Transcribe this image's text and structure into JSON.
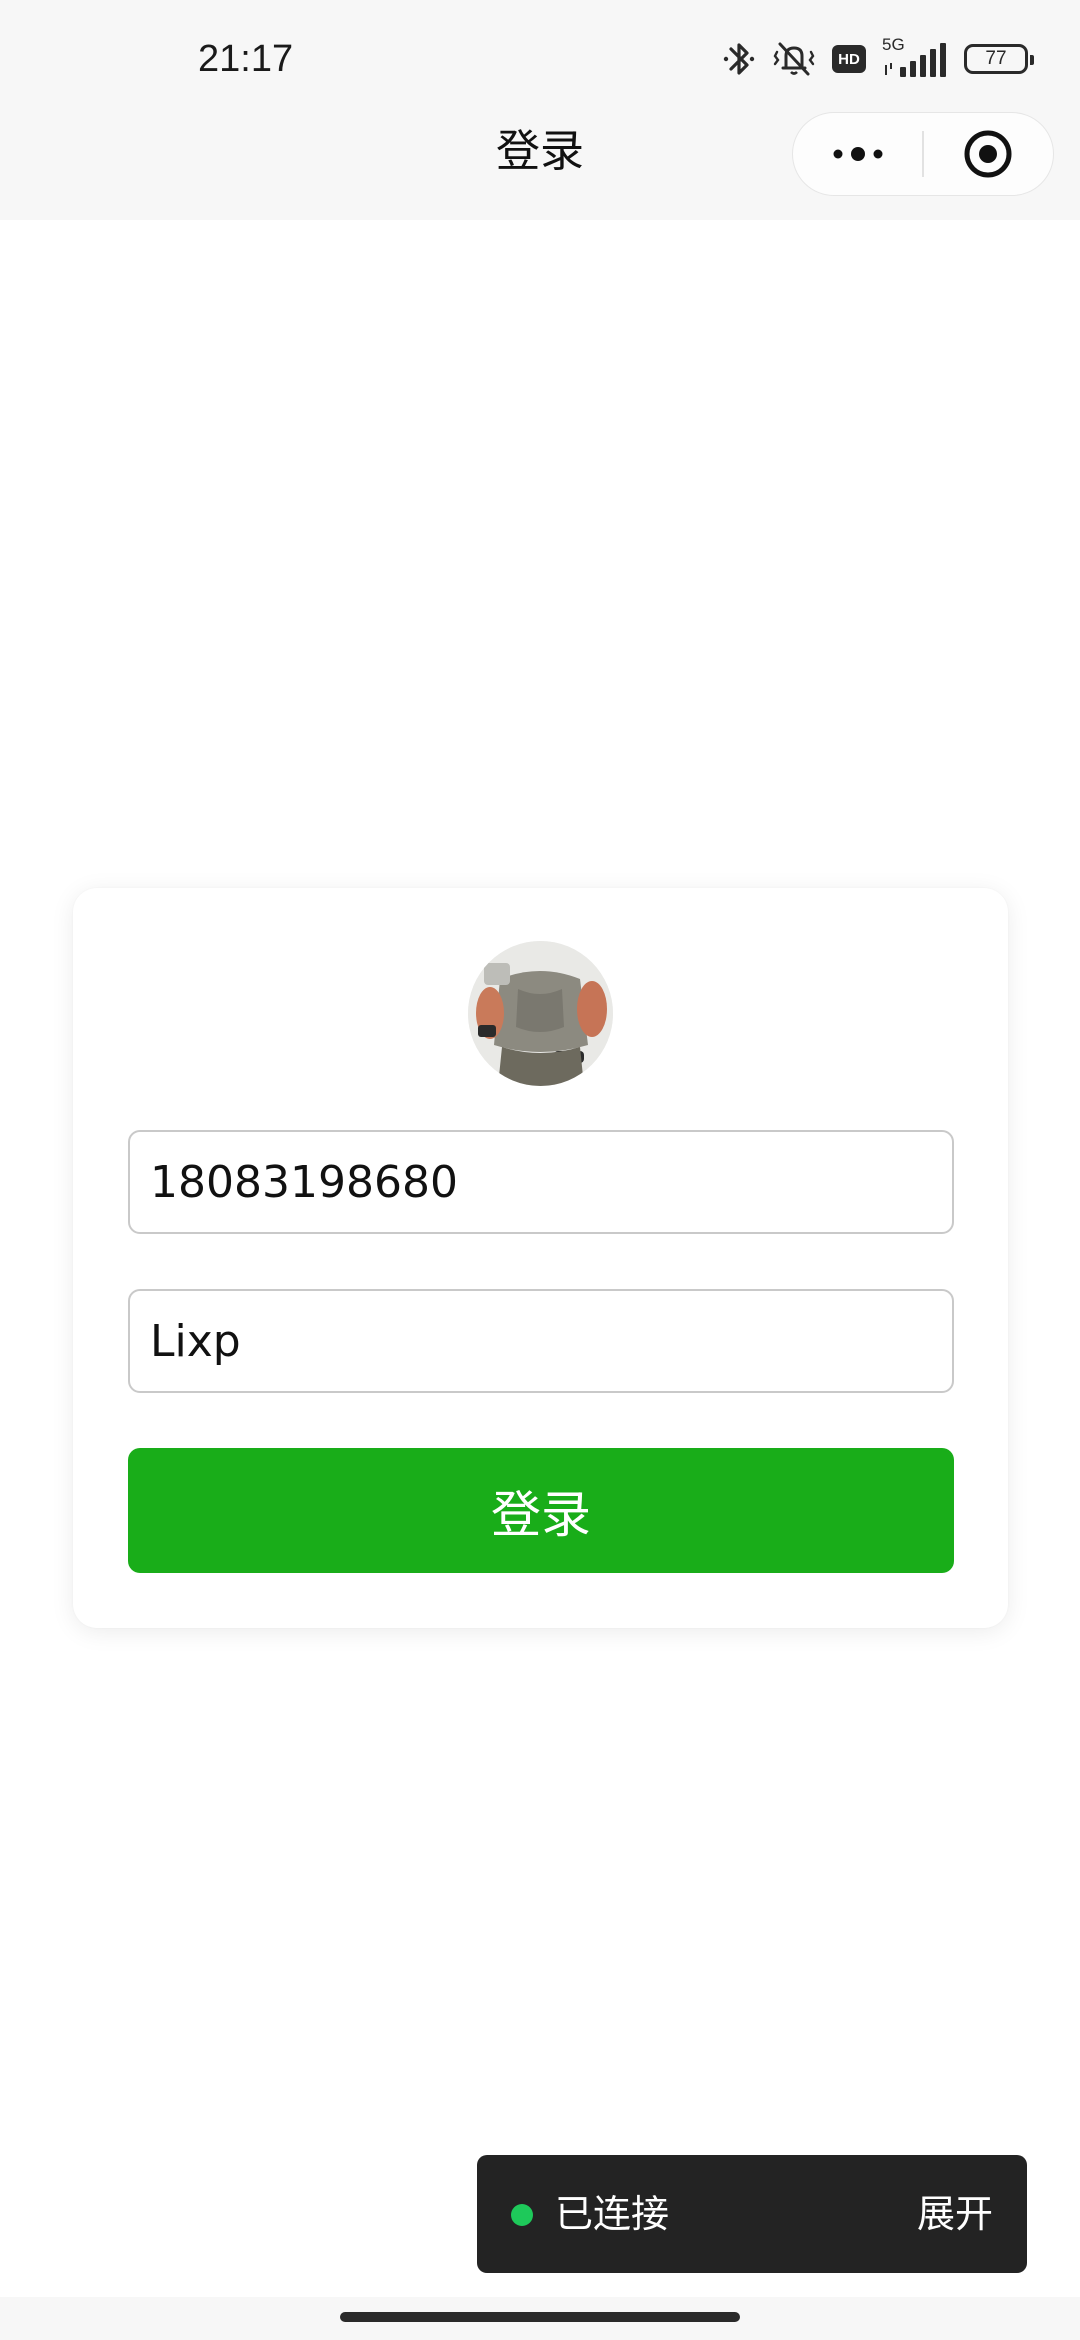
{
  "status_bar": {
    "time": "21:17",
    "network": "5G",
    "hd": "HD",
    "battery": "77"
  },
  "header": {
    "title": "登录"
  },
  "login_form": {
    "avatar_description": "profile-avatar",
    "phone_value": "18083198680",
    "password_value": "Lixp",
    "submit_label": "登录"
  },
  "connection_toast": {
    "status": "已连接",
    "expand_label": "展开",
    "status_color": "#1ec95a"
  },
  "colors": {
    "primary_button": "#19ad19",
    "toast_background": "#232323"
  }
}
